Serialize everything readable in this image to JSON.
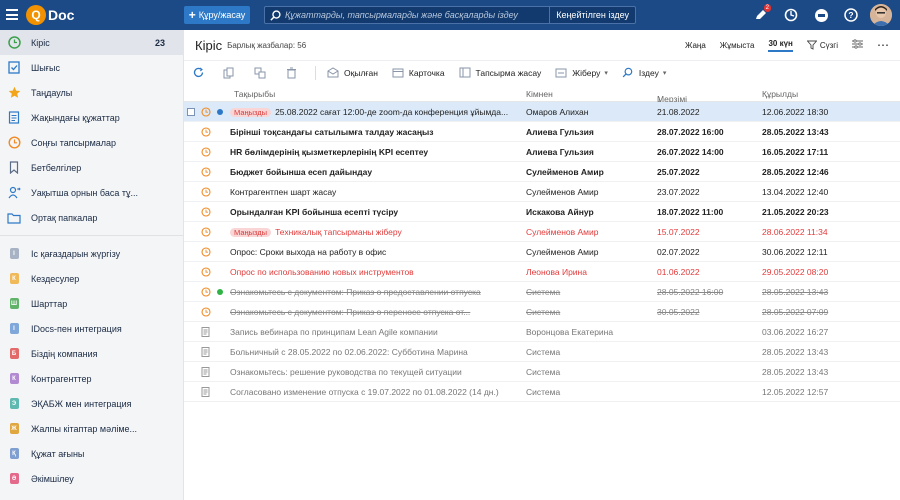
{
  "app": {
    "logo_letter": "Q",
    "logo_text": "Doc"
  },
  "header": {
    "create_label": "Құру/жасау",
    "search_placeholder": "Құжаттарды, тапсырмаларды және басқаларды іздеу",
    "advanced_search_label": "Кеңейтілген іздеу",
    "notification_count": "2"
  },
  "sidebar": {
    "primary": [
      {
        "label": "Кіріс",
        "count": "23",
        "icon": "inbox-clock-icon"
      },
      {
        "label": "Шығыс",
        "icon": "outbox-icon"
      },
      {
        "label": "Таңдаулы",
        "icon": "star-icon"
      },
      {
        "label": "Жақындағы құжаттар",
        "icon": "document-icon"
      },
      {
        "label": "Соңғы тапсырмалар",
        "icon": "history-icon"
      },
      {
        "label": "Бетбелгілер",
        "icon": "bookmark-icon"
      },
      {
        "label": "Уақытша орнын баса тұ...",
        "icon": "user-swap-icon"
      },
      {
        "label": "Ортақ папкалар",
        "icon": "folder-icon"
      }
    ],
    "modules": [
      {
        "label": "Іс қағаздарын жүргізу",
        "letter": "І",
        "color": "#a7b3c4"
      },
      {
        "label": "Кездесулер",
        "letter": "К",
        "color": "#f0b95a"
      },
      {
        "label": "Шарттар",
        "letter": "Ш",
        "color": "#62b36a"
      },
      {
        "label": "IDocs-пен интеграция",
        "letter": "I",
        "color": "#7fa7d9"
      },
      {
        "label": "Біздің компания",
        "letter": "Б",
        "color": "#e36a6a"
      },
      {
        "label": "Контрагенттер",
        "letter": "К",
        "color": "#b18ad1"
      },
      {
        "label": "ЭҚАБЖ мен интеграция",
        "letter": "Э",
        "color": "#5fb9b0"
      },
      {
        "label": "Жалпы кітаптар мәліме...",
        "letter": "Ж",
        "color": "#e0a63f"
      },
      {
        "label": "Құжат ағыны",
        "letter": "Қ",
        "color": "#7f9fd0"
      },
      {
        "label": "Әкімшілеу",
        "letter": "Ә",
        "color": "#e36a8a"
      }
    ]
  },
  "main": {
    "title": "Кіріс",
    "total_label": "Барлық жазбалар: 56",
    "filters": [
      "Жаңа",
      "Жұмыста",
      "30 күн"
    ],
    "filter_label": "Сүзгі",
    "toolbar": {
      "read_label": "Оқылған",
      "card_label": "Карточка",
      "task_label": "Тапсырма жасау",
      "send_label": "Жіберу",
      "search_label": "Іздеу"
    },
    "columns": {
      "subject": "Тақырыбы",
      "from": "Кімнен",
      "due": "Мерзімі",
      "created": "Құрылды"
    },
    "rows": [
      {
        "subject": "25.08.2022 сағат 12:00-де zoom-да конференция ұйымда...",
        "tag": "Маңызды",
        "from": "Омаров Алихан",
        "due": "21.08.2022",
        "created": "12.06.2022 18:30",
        "style": "selected",
        "icon": "clock",
        "dot": "#2d79c7"
      },
      {
        "subject": "Бірінші тоқсандағы сатылымға талдау жасаңыз",
        "from": "Алиева Гульзия",
        "due": "28.07.2022 16:00",
        "created": "28.05.2022 13:43",
        "style": "bold",
        "icon": "clock"
      },
      {
        "subject": "HR бөлімдерінің қызметкерлерінің KPI есептеу",
        "from": "Алиева Гульзия",
        "due": "26.07.2022 14:00",
        "created": "16.05.2022 17:11",
        "style": "bold",
        "icon": "clock"
      },
      {
        "subject": "Бюджет бойынша есеп дайындау",
        "from": "Сулейменов Амир",
        "due": "25.07.2022",
        "created": "28.05.2022 12:46",
        "style": "bold",
        "icon": "clock"
      },
      {
        "subject": "Контрагентпен шарт жасау",
        "from": "Сулейменов Амир",
        "due": "23.07.2022",
        "created": "13.04.2022 12:40",
        "style": "normal",
        "icon": "clock"
      },
      {
        "subject": "Орындалған KPI бойынша есепті түсіру",
        "from": "Искакова Айнур",
        "due": "18.07.2022 11:00",
        "created": "21.05.2022 20:23",
        "style": "bold",
        "icon": "clock"
      },
      {
        "subject": "Техникалық тапсырманы жіберу",
        "tag": "Маңызды",
        "from": "Сулейменов Амир",
        "due": "15.07.2022",
        "created": "28.06.2022 11:34",
        "style": "red",
        "icon": "clock"
      },
      {
        "subject": "Опрос: Сроки выхода на работу в офис",
        "from": "Сулейменов Амир",
        "due": "02.07.2022",
        "created": "30.06.2022 12:11",
        "style": "normal",
        "icon": "clock"
      },
      {
        "subject": "Опрос по использованию новых инструментов",
        "from": "Леонова Ирина",
        "due": "01.06.2022",
        "created": "29.05.2022 08:20",
        "style": "red",
        "icon": "clock"
      },
      {
        "subject": "Ознакомьтесь с документом: Приказ о предоставлении отпуска",
        "from": "Система",
        "due": "28.05.2022 16:00",
        "created": "28.05.2022 13:43",
        "style": "strike",
        "icon": "clock",
        "dot": "#2fb344"
      },
      {
        "subject": "Ознакомьтесь с документом: Приказ о переносе отпуска от...",
        "from": "Система",
        "due": "30.05.2022",
        "created": "28.05.2022 07:09",
        "style": "strike",
        "icon": "clock"
      },
      {
        "subject": "Запись вебинара по принципам Lean Agile компании",
        "from": "Воронцова Екатерина",
        "due": "",
        "created": "03.06.2022 16:27",
        "style": "grey",
        "icon": "doc"
      },
      {
        "subject": "Больничный с 28.05.2022 по 02.06.2022: Субботина Марина",
        "from": "Система",
        "due": "",
        "created": "28.05.2022 13:43",
        "style": "grey",
        "icon": "doc"
      },
      {
        "subject": "Ознакомьтесь: решение руководства по текущей ситуации",
        "from": "Система",
        "due": "",
        "created": "28.05.2022 13:43",
        "style": "grey",
        "icon": "doc"
      },
      {
        "subject": "Согласовано изменение отпуска с 19.07.2022 по 01.08.2022 (14 дн.)",
        "from": "Система",
        "due": "",
        "created": "12.05.2022 12:57",
        "style": "grey",
        "icon": "doc"
      }
    ]
  }
}
